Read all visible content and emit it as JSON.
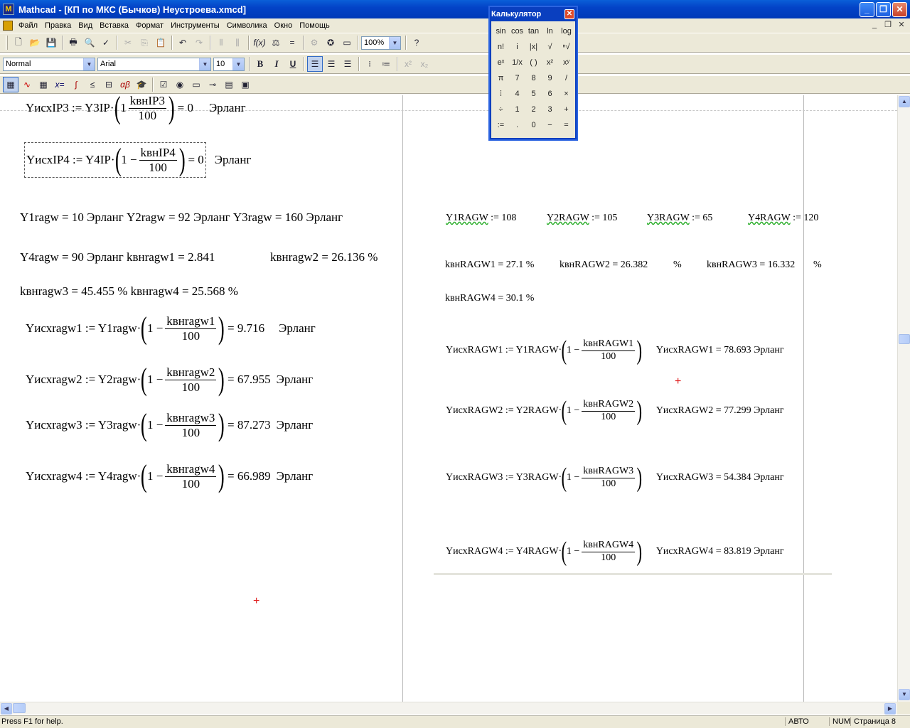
{
  "window": {
    "title": "Mathcad - [КП по МКС (Бычков) Неустроева.xmcd]",
    "minimize_glyph": "_",
    "maximize_glyph": "❐",
    "close_glyph": "✕"
  },
  "menu": {
    "items": [
      "Файл",
      "Правка",
      "Вид",
      "Вставка",
      "Формат",
      "Инструменты",
      "Символика",
      "Окно",
      "Помощь"
    ],
    "mdi_min": "_",
    "mdi_restore": "❐",
    "mdi_close": "✕"
  },
  "toolbar": {
    "zoom": "100%",
    "style": "Normal",
    "font": "Arial",
    "size": "10"
  },
  "calculator": {
    "title": "Калькулятор",
    "keys": [
      "sin",
      "cos",
      "tan",
      "ln",
      "log",
      "n!",
      "i",
      "|x|",
      "√",
      "ⁿ√",
      "eˣ",
      "1/x",
      "( )",
      "x²",
      "xʸ",
      "π",
      "7",
      "8",
      "9",
      "/",
      "⁞",
      "4",
      "5",
      "6",
      "×",
      "÷",
      "1",
      "2",
      "3",
      "+",
      ":=",
      ".",
      "0",
      "−",
      "="
    ]
  },
  "left": {
    "yiskhip3": {
      "lhs": "YисхIP3 := Y3IP·",
      "one": "1",
      "num": "kвнIP3",
      "den": "100",
      "res": "= 0",
      "unit": "Эрланг"
    },
    "yiskhip4": {
      "lhs": "YисхIP4 := Y4IP·",
      "one": "1 −",
      "num": "kвнIP4",
      "den": "100",
      "res": "= 0",
      "unit": "Эрланг"
    },
    "line1": "Y1ragw = 10 Эрланг   Y2ragw = 92 Эрланг   Y3ragw = 160 Эрланг",
    "line2a": "Y4ragw = 90 Эрланг   kвнragw1 = 2.841",
    "line2b": "kвнragw2 = 26.136  %",
    "line3": "kвнragw3 = 45.455  %   kвнragw4 = 25.568  %",
    "eqs": [
      {
        "lhs": "Yисхragw1 := Y1ragw·",
        "one": "1 −",
        "num": "kвнragw1",
        "den": "100",
        "res": "= 9.716",
        "unit": "Эрланг"
      },
      {
        "lhs": "Yисхragw2 := Y2ragw·",
        "one": "1 −",
        "num": "kвнragw2",
        "den": "100",
        "res": "= 67.955",
        "unit": "Эрланг"
      },
      {
        "lhs": "Yисхragw3 := Y3ragw·",
        "one": "1 −",
        "num": "kвнragw3",
        "den": "100",
        "res": "= 87.273",
        "unit": "Эрланг"
      },
      {
        "lhs": "Yисхragw4 := Y4ragw·",
        "one": "1 −",
        "num": "kвнragw4",
        "den": "100",
        "res": "= 66.989",
        "unit": "Эрланг"
      }
    ]
  },
  "right": {
    "assign": [
      {
        "name": "Y1RAGW",
        "val": ":= 108"
      },
      {
        "name": "Y2RAGW",
        "val": ":= 105"
      },
      {
        "name": "Y3RAGW",
        "val": ":= 65"
      },
      {
        "name": "Y4RAGW",
        "val": ":= 120"
      }
    ],
    "k1": "kвнRAGW1 = 27.1 %",
    "k2": "kвнRAGW2 = 26.382",
    "k2u": "%",
    "k3": "kвнRAGW3 = 16.332",
    "k3u": "%",
    "k4": "kвнRAGW4 = 30.1 %",
    "eqs": [
      {
        "lhs": "YисхRAGW1 := Y1RAGW·",
        "one": "1 −",
        "num": "kвнRAGW1",
        "den": "100",
        "res": "YисхRAGW1 = 78.693  Эрланг"
      },
      {
        "lhs": "YисхRAGW2 := Y2RAGW·",
        "one": "1 −",
        "num": "kвнRAGW2",
        "den": "100",
        "res": "YисхRAGW2 = 77.299  Эрланг"
      },
      {
        "lhs": "YисхRAGW3 := Y3RAGW·",
        "one": "1 −",
        "num": "kвнRAGW3",
        "den": "100",
        "res": "YисхRAGW3 = 54.384  Эрланг"
      },
      {
        "lhs": "YисхRAGW4 := Y4RAGW·",
        "one": "1 −",
        "num": "kвнRAGW4",
        "den": "100",
        "res": "YисхRAGW4 = 83.819  Эрланг"
      }
    ]
  },
  "status": {
    "help": "Press F1 for help.",
    "mode": "АВТО",
    "num": "NUM",
    "page": "Страница 8"
  }
}
